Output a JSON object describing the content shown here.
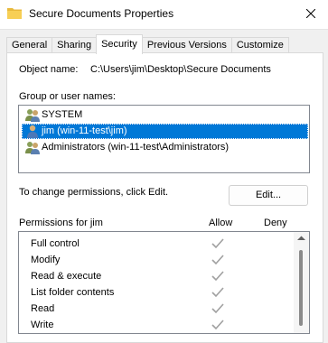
{
  "window": {
    "title": "Secure Documents Properties"
  },
  "tabs": [
    {
      "label": "General"
    },
    {
      "label": "Sharing"
    },
    {
      "label": "Security"
    },
    {
      "label": "Previous Versions"
    },
    {
      "label": "Customize"
    }
  ],
  "active_tab": "Security",
  "object": {
    "label": "Object name:",
    "value": "C:\\Users\\jim\\Desktop\\Secure Documents"
  },
  "groups": {
    "label": "Group or user names:",
    "items": [
      {
        "name": "SYSTEM",
        "icon": "users-icon"
      },
      {
        "name": "jim (win-11-test\\jim)",
        "icon": "user-icon",
        "selected": true
      },
      {
        "name": "Administrators (win-11-test\\Administrators)",
        "icon": "users-icon"
      }
    ]
  },
  "change_text": "To change permissions, click Edit.",
  "edit_button": "Edit...",
  "permissions": {
    "label": "Permissions for jim",
    "allow_header": "Allow",
    "deny_header": "Deny",
    "rows": [
      {
        "name": "Full control",
        "allow": true,
        "deny": false
      },
      {
        "name": "Modify",
        "allow": true,
        "deny": false
      },
      {
        "name": "Read & execute",
        "allow": true,
        "deny": false
      },
      {
        "name": "List folder contents",
        "allow": true,
        "deny": false
      },
      {
        "name": "Read",
        "allow": true,
        "deny": false
      },
      {
        "name": "Write",
        "allow": true,
        "deny": false
      }
    ]
  },
  "colors": {
    "selection": "#0078d7",
    "check": "#a0a0a0"
  }
}
